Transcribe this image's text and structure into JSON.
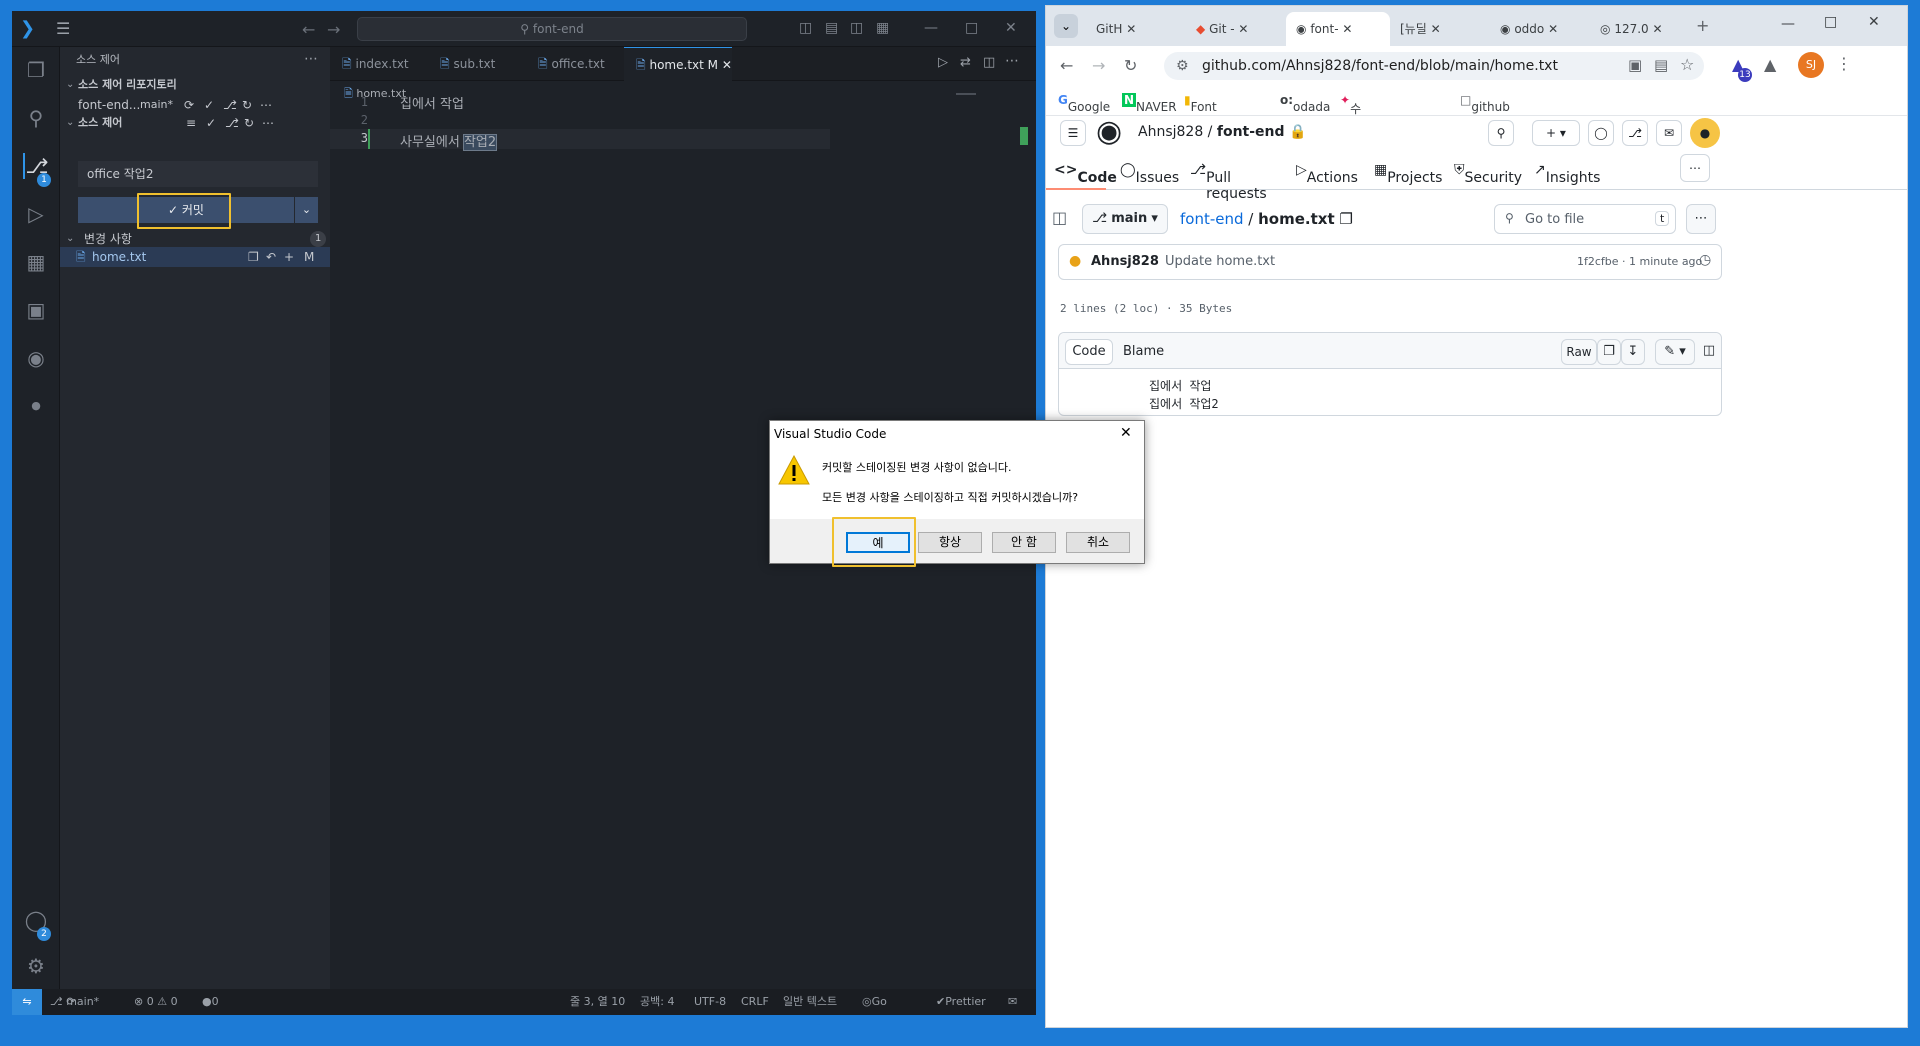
{
  "vscode": {
    "title_search": "font-end",
    "sidebar": {
      "header": "소스 제어",
      "repos_section": "소스 제어 리포지토리",
      "repo_name": "font-end...",
      "repo_branch": "main*",
      "scm_section": "소스 제어",
      "commit_message": "office 작업2",
      "commit_button": "✓ 커밋",
      "changes_section": "변경 사항",
      "changes_count": "1",
      "changed_file": "home.txt",
      "changed_file_status": "M"
    },
    "activity_badges": {
      "scm": "1",
      "accounts": "2"
    },
    "tabs": [
      {
        "label": "index.txt"
      },
      {
        "label": "sub.txt"
      },
      {
        "label": "office.txt"
      },
      {
        "label": "home.txt",
        "suffix": "M"
      }
    ],
    "breadcrumb": "home.txt",
    "editor_lines": [
      {
        "num": "1",
        "text": "집에서 작업"
      },
      {
        "num": "2",
        "text": ""
      },
      {
        "num": "3",
        "text": "사무실에서 ",
        "selected": "작업2"
      }
    ],
    "status": {
      "branch": "main*",
      "problems": "⊗ 0 ⚠ 0",
      "ports": "0",
      "position": "줄 3, 열 10",
      "spaces": "공백: 4",
      "encoding": "UTF-8",
      "eol": "CRLF",
      "language": "일반 텍스트",
      "golive": "Go Live",
      "prettier": "Prettier"
    }
  },
  "chrome": {
    "tabs": [
      "GitH",
      "Git -",
      "font-",
      "[뉴딜",
      "oddo",
      "127.0"
    ],
    "url": "github.com/Ahnsj828/font-end/blob/main/home.txt",
    "bookmarks": [
      "Google",
      "NAVER",
      "Font Awesome",
      "odada",
      "수업자료(채널) - [...",
      "github"
    ],
    "profile": "SJ",
    "extension_badge": "13"
  },
  "github": {
    "owner": "Ahnsj828",
    "repo": "font-end",
    "nav": [
      "Code",
      "Issues",
      "Pull requests",
      "Actions",
      "Projects",
      "Security",
      "Insights"
    ],
    "branch": "main",
    "path_repo": "font-end",
    "path_file": "home.txt",
    "go_to_file": "Go to file",
    "go_to_file_key": "t",
    "commit_author": "Ahnsj828",
    "commit_message": "Update home.txt",
    "commit_meta": "1f2cfbe · 1 minute ago",
    "file_info": "2 lines (2 loc) · 35 Bytes",
    "view_tabs": [
      "Code",
      "Blame"
    ],
    "raw_button": "Raw",
    "lines": [
      "집에서 작업",
      "집에서 작업2"
    ]
  },
  "dialog": {
    "title": "Visual Studio Code",
    "line1": "커밋할 스테이징된 변경 사항이 없습니다.",
    "line2": "모든 변경 사항을 스테이징하고 직접 커밋하시겠습니까?",
    "buttons": [
      "예",
      "항상",
      "안 함",
      "취소"
    ]
  },
  "colors": {
    "vscode_accent": "#2f94e8",
    "highlight": "#f0c02e",
    "desktop": "#1d7bd6"
  }
}
